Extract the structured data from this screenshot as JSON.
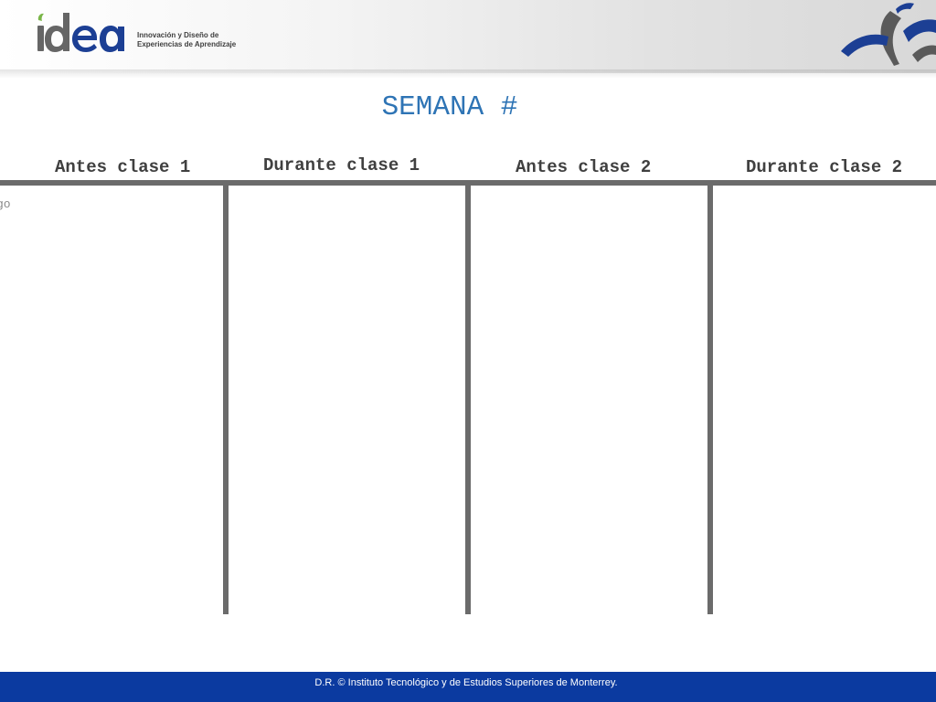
{
  "header": {
    "logo_text": "idea",
    "org_line1": "Innovación y Diseño de",
    "org_line2": "Experiencias de Aprendizaje"
  },
  "slide": {
    "title": "SEMANA #",
    "side_fragment": "go"
  },
  "columns": [
    {
      "label": "Antes clase 1"
    },
    {
      "label": "Durante clase 1"
    },
    {
      "label": "Antes clase 2"
    },
    {
      "label": "Durante clase 2"
    }
  ],
  "footer": {
    "copyright": "D.R. © Instituto Tecnológico y de Estudios Superiores de Monterrey."
  },
  "colors": {
    "title": "#2e74b5",
    "grid_lines": "#6b6b6b",
    "footer_bg": "#0b3aa0",
    "logo_green": "#7ab648",
    "logo_blue": "#1c3f94",
    "logo_gray": "#666666"
  }
}
